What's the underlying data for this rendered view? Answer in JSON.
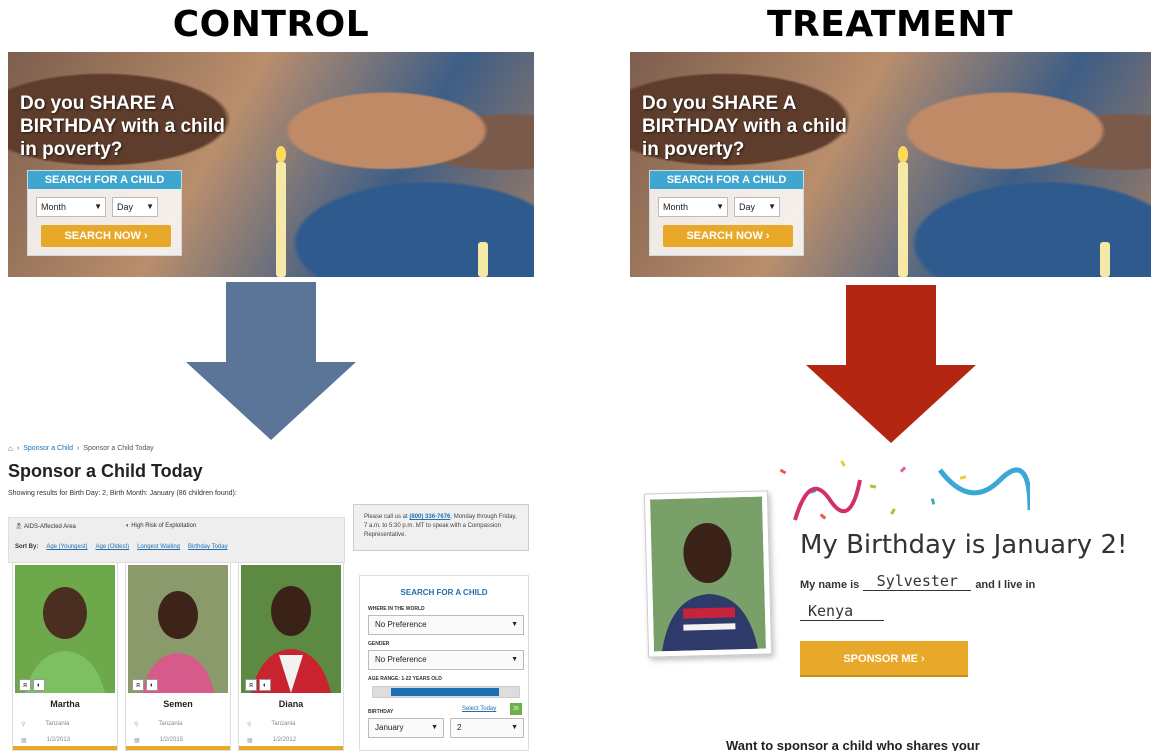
{
  "labels": {
    "control": "CONTROL",
    "treatment": "TREATMENT"
  },
  "hero": {
    "headline": "Do you SHARE A BIRTHDAY with a child in poverty?",
    "search_title": "SEARCH FOR A CHILD",
    "month_placeholder": "Month",
    "day_placeholder": "Day",
    "button": "SEARCH NOW ›"
  },
  "arrows": {
    "control_color": "#5b7599",
    "treatment_color": "#b32712"
  },
  "control_page": {
    "breadcrumb": [
      "Sponsor a Child",
      "Sponsor a Child Today"
    ],
    "title": "Sponsor a Child Today",
    "results": "Showing results for Birth Day: 2, Birth Month: January (86 children found):",
    "legend": [
      "AIDS-Affected Area",
      "High Risk of Exploitation"
    ],
    "sort_label": "Sort By:",
    "sort_options": [
      "Age (Youngest)",
      "Age (Oldest)",
      "Longest Waiting",
      "Birthday Today"
    ],
    "children": [
      {
        "name": "Martha",
        "country": "Tanzania",
        "birthdate": "1/2/2013"
      },
      {
        "name": "Semen",
        "country": "Tanzania",
        "birthdate": "1/2/2015"
      },
      {
        "name": "Diana",
        "country": "Tanzania",
        "birthdate": "1/2/2012"
      }
    ],
    "call_pre": "Please call us at ",
    "call_phone": "(800) 336-7676",
    "call_post": ", Monday through Friday, 7 a.m. to 5:30 p.m. MT to speak with a Compassion Representative.",
    "search": {
      "title": "SEARCH FOR A CHILD",
      "world_label": "WHERE IN THE WORLD",
      "world_value": "No Preference",
      "gender_label": "GENDER",
      "gender_value": "No Preference",
      "age_label": "AGE RANGE: 1-22 YEARS OLD",
      "birthday_label": "BIRTHDAY",
      "select_today": "Select Today",
      "cal_day": "26",
      "month_value": "January",
      "day_value": "2"
    }
  },
  "treatment_page": {
    "headline": "My Birthday is January 2!",
    "name_prefix": "My name is",
    "child_name": "Sylvester",
    "name_suffix": "and I live in",
    "country": "Kenya",
    "button": "SPONSOR ME ›",
    "footer_partial": "Want to sponsor a child who shares your"
  }
}
